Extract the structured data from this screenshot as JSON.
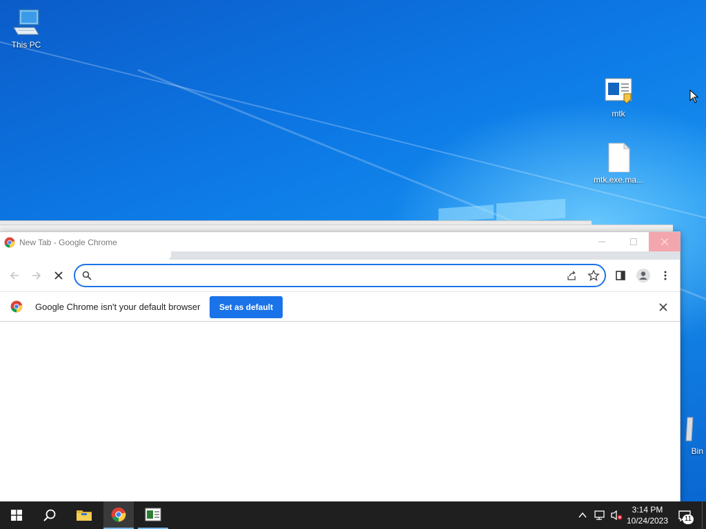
{
  "desktop": {
    "icons": [
      {
        "label": "This PC",
        "icon": "computer-icon"
      },
      {
        "label": "mtk",
        "icon": "mtk-app-icon"
      },
      {
        "label": "mtk.exe.ma...",
        "icon": "file-icon"
      },
      {
        "label": "Bin",
        "icon": "recycle-bin-icon"
      }
    ]
  },
  "chrome_window": {
    "title": "New Tab - Google Chrome",
    "omnibox": {
      "value": "",
      "placeholder": ""
    },
    "infobar": {
      "message": "Google Chrome isn't your default browser",
      "button_label": "Set as default"
    },
    "colors": {
      "accent": "#1a73e8",
      "close_hover": "#f3a6ae"
    }
  },
  "taskbar": {
    "pinned": [
      "windows-start-icon",
      "search-icon",
      "file-explorer-icon",
      "chrome-icon",
      "mtk-app-icon"
    ],
    "clock": {
      "time": "3:14 PM",
      "date": "10/24/2023"
    },
    "notification_count": "11"
  }
}
